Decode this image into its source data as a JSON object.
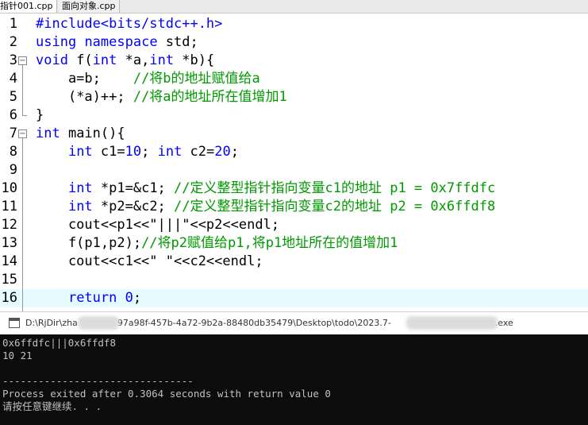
{
  "tabs": [
    {
      "label": "指针001.cpp",
      "active": true
    },
    {
      "label": "面向对象.cpp",
      "active": false
    }
  ],
  "code_lines": [
    {
      "n": "1",
      "html_parts": [
        {
          "t": "#include<bits/stdc++.h>",
          "c": "pp"
        }
      ]
    },
    {
      "n": "2",
      "html_parts": [
        {
          "t": "using",
          "c": "kw"
        },
        {
          "t": " "
        },
        {
          "t": "namespace",
          "c": "kw"
        },
        {
          "t": " std;"
        }
      ]
    },
    {
      "n": "3",
      "fold": "open",
      "html_parts": [
        {
          "t": "void",
          "c": "kw"
        },
        {
          "t": " f("
        },
        {
          "t": "int",
          "c": "kw"
        },
        {
          "t": " *a,"
        },
        {
          "t": "int",
          "c": "kw"
        },
        {
          "t": " *b){"
        }
      ]
    },
    {
      "n": "4",
      "html_parts": [
        {
          "t": "    a=b;    "
        },
        {
          "t": "//将b的地址赋值给a",
          "c": "cm"
        }
      ]
    },
    {
      "n": "5",
      "html_parts": [
        {
          "t": "    (*a)++; "
        },
        {
          "t": "//将a的地址所在值增加1",
          "c": "cm"
        }
      ]
    },
    {
      "n": "6",
      "foldend": true,
      "html_parts": [
        {
          "t": "}"
        }
      ]
    },
    {
      "n": "7",
      "fold": "open",
      "html_parts": [
        {
          "t": "int",
          "c": "kw"
        },
        {
          "t": " main(){"
        }
      ]
    },
    {
      "n": "8",
      "html_parts": [
        {
          "t": "    "
        },
        {
          "t": "int",
          "c": "kw"
        },
        {
          "t": " c1="
        },
        {
          "t": "10",
          "c": "num"
        },
        {
          "t": "; "
        },
        {
          "t": "int",
          "c": "kw"
        },
        {
          "t": " c2="
        },
        {
          "t": "20",
          "c": "num"
        },
        {
          "t": ";"
        }
      ]
    },
    {
      "n": "9",
      "html_parts": [
        {
          "t": ""
        }
      ]
    },
    {
      "n": "10",
      "html_parts": [
        {
          "t": "    "
        },
        {
          "t": "int",
          "c": "kw"
        },
        {
          "t": " *p1=&c1; "
        },
        {
          "t": "//定义整型指针指向变量c1的地址 p1 = 0x7ffdfc",
          "c": "cm"
        }
      ]
    },
    {
      "n": "11",
      "html_parts": [
        {
          "t": "    "
        },
        {
          "t": "int",
          "c": "kw"
        },
        {
          "t": " *p2=&c2; "
        },
        {
          "t": "//定义整型指针指向变量c2的地址 p2 = 0x6ffdf8",
          "c": "cm"
        }
      ]
    },
    {
      "n": "12",
      "html_parts": [
        {
          "t": "    cout<<p1<<\"|||\"<<p2<<endl;"
        }
      ]
    },
    {
      "n": "13",
      "html_parts": [
        {
          "t": "    f(p1,p2);"
        },
        {
          "t": "//将p2赋值给p1,将p1地址所在的值增加1",
          "c": "cm"
        }
      ]
    },
    {
      "n": "14",
      "html_parts": [
        {
          "t": "    cout<<c1<<\" \"<<c2<<endl;"
        }
      ]
    },
    {
      "n": "15",
      "html_parts": [
        {
          "t": ""
        }
      ]
    },
    {
      "n": "16",
      "highlight": true,
      "html_parts": [
        {
          "t": "    "
        },
        {
          "t": "return",
          "c": "kw"
        },
        {
          "t": " "
        },
        {
          "t": "0",
          "c": "num"
        },
        {
          "t": ";"
        }
      ]
    }
  ],
  "console": {
    "path_left": "D:\\RjDir\\zha",
    "path_mid": "97a98f-457b-4a72-9b2a-88480db35479\\Desktop\\todo\\2023.7-",
    "path_right": "001.exe",
    "output_lines": [
      "0x6ffdfc|||0x6ffdf8",
      "10 21",
      "",
      "--------------------------------",
      "Process exited after 0.3064 seconds with return value 0",
      "请按任意键继续. . ."
    ]
  },
  "colors": {
    "keyword": "#0000ff",
    "comment": "#009900",
    "highlight_line": "#e6fbff",
    "console_bg": "#0c0c0c"
  }
}
